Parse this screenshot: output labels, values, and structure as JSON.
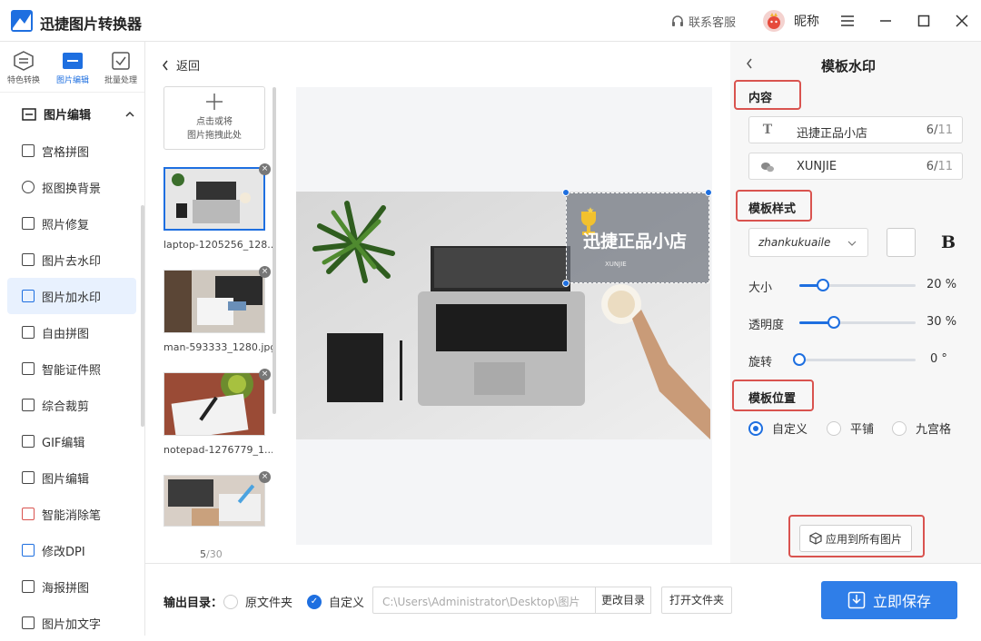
{
  "app": {
    "title": "迅捷图片转换器"
  },
  "header": {
    "support_label": "联系客服",
    "nickname": "昵称"
  },
  "nav_tabs": [
    {
      "label": "特色转换",
      "icon": "convert-icon"
    },
    {
      "label": "图片编辑",
      "icon": "image-edit-icon",
      "active": true
    },
    {
      "label": "批量处理",
      "icon": "batch-icon"
    }
  ],
  "sidebar": {
    "section": "图片编辑",
    "items": [
      {
        "label": "宫格拼图",
        "icon": "grid-icon"
      },
      {
        "label": "抠图换背景",
        "icon": "cutout-icon"
      },
      {
        "label": "照片修复",
        "icon": "repair-icon"
      },
      {
        "label": "图片去水印",
        "icon": "remove-watermark-icon"
      },
      {
        "label": "图片加水印",
        "icon": "add-watermark-icon",
        "active": true
      },
      {
        "label": "自由拼图",
        "icon": "free-collage-icon"
      },
      {
        "label": "智能证件照",
        "icon": "id-photo-icon"
      },
      {
        "label": "综合裁剪",
        "icon": "crop-icon"
      },
      {
        "label": "GIF编辑",
        "icon": "gif-icon"
      },
      {
        "label": "图片编辑",
        "icon": "edit-icon"
      },
      {
        "label": "智能消除笔",
        "icon": "eraser-icon"
      },
      {
        "label": "修改DPI",
        "icon": "dpi-icon"
      },
      {
        "label": "海报拼图",
        "icon": "poster-icon"
      },
      {
        "label": "图片加文字",
        "icon": "text-icon"
      }
    ]
  },
  "thumbs": {
    "back_label": "返回",
    "add_line1": "点击或将",
    "add_line2": "图片拖拽此处",
    "items": [
      {
        "name": "laptop-1205256_128..."
      },
      {
        "name": "man-593333_1280.jpg"
      },
      {
        "name": "notepad-1276779_1..."
      },
      {
        "name": ""
      }
    ],
    "page_current": "5",
    "page_total": "/30"
  },
  "preview": {
    "watermark_text": "迅捷正品小店",
    "watermark_sub": "XUNJIE"
  },
  "panel": {
    "title": "模板水印",
    "content_label": "内容",
    "field1": {
      "text": "迅捷正品小店",
      "count": "6/",
      "max": "11"
    },
    "field2": {
      "text": "XUNJIE",
      "count": "6/",
      "max": "11"
    },
    "style_label": "模板样式",
    "font_name": "zhankukuaile",
    "bold_label": "B",
    "size": {
      "label": "大小",
      "value": 20,
      "value_text": "20",
      "unit": "%"
    },
    "opacity": {
      "label": "透明度",
      "value": 30,
      "value_text": "30",
      "unit": "%"
    },
    "rotate": {
      "label": "旋转",
      "value": 0,
      "value_text": "0",
      "unit": "°"
    },
    "position_label": "模板位置",
    "positions": [
      {
        "label": "自定义",
        "checked": true
      },
      {
        "label": "平铺",
        "checked": false
      },
      {
        "label": "九宫格",
        "checked": false
      }
    ],
    "apply_all": "应用到所有图片"
  },
  "bottom": {
    "output_label": "输出目录：",
    "option_original": "原文件夹",
    "option_custom": "自定义",
    "path": "C:\\Users\\Administrator\\Desktop\\图片",
    "change_dir": "更改目录",
    "open_folder": "打开文件夹",
    "save_now": "立即保存"
  },
  "colors": {
    "accent": "#1e6fe0",
    "highlight": "#d9534f",
    "save": "#2f7ee8"
  }
}
